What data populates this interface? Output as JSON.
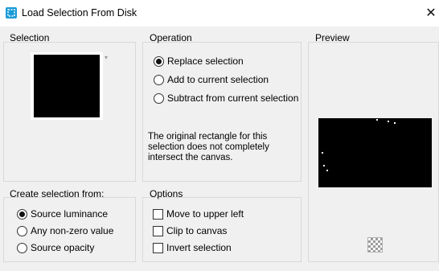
{
  "window": {
    "title": "Load Selection From Disk",
    "close_glyph": "✕",
    "icon": "psp-selection-icon"
  },
  "selection": {
    "label": "Selection",
    "dropdown_arrow": "▾"
  },
  "operation": {
    "label": "Operation",
    "options": [
      {
        "label": "Replace selection",
        "checked": true
      },
      {
        "label": "Add to current selection",
        "checked": false
      },
      {
        "label": "Subtract from current selection",
        "checked": false
      }
    ],
    "note": "The original rectangle for this selection does not completely intersect the canvas."
  },
  "preview": {
    "label": "Preview",
    "icon": "transparency-checker-icon"
  },
  "create_from": {
    "label": "Create selection from:",
    "options": [
      {
        "label": "Source luminance",
        "checked": true
      },
      {
        "label": "Any non-zero value",
        "checked": false
      },
      {
        "label": "Source opacity",
        "checked": false
      }
    ]
  },
  "options": {
    "label": "Options",
    "items": [
      {
        "label": "Move to upper left",
        "checked": false
      },
      {
        "label": "Clip to canvas",
        "checked": false
      },
      {
        "label": "Invert selection",
        "checked": false
      }
    ]
  },
  "colors": {
    "dialog_bg": "#f0f0f0",
    "title_bg": "#ffffff",
    "panel_border": "#d9d9d9",
    "app_icon": "#1a9bd6"
  }
}
